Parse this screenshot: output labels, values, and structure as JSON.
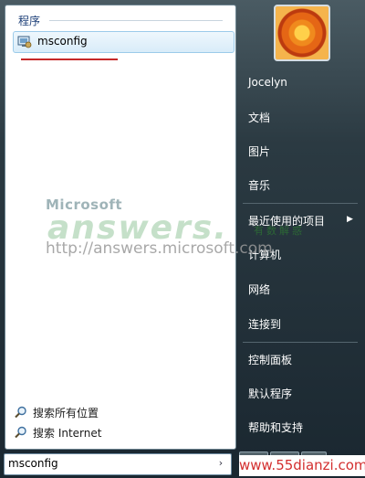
{
  "left_panel": {
    "group_title": "程序",
    "program": {
      "label": "msconfig",
      "icon": "system-config-icon"
    },
    "search_links": [
      {
        "label": "搜索所有位置",
        "icon": "magnifier-icon"
      },
      {
        "label": "搜索 Internet",
        "icon": "magnifier-icon"
      }
    ],
    "search_box": {
      "value": "msconfig",
      "go_icon": "arrow-right-icon"
    }
  },
  "right_panel": {
    "user_name": "Jocelyn",
    "items": [
      {
        "label": "文档"
      },
      {
        "label": "图片"
      },
      {
        "label": "音乐"
      },
      {
        "label": "最近使用的项目",
        "has_submenu": true
      },
      {
        "label": "计算机"
      },
      {
        "label": "网络"
      },
      {
        "label": "连接到"
      },
      {
        "label": "控制面板"
      },
      {
        "label": "默认程序"
      },
      {
        "label": "帮助和支持"
      }
    ]
  },
  "watermark": {
    "brand": "Microsoft",
    "word": "answers.",
    "chinese": "有数解惑",
    "url": "http://answers.microsoft.com"
  },
  "site_badge": {
    "text": "www.55dianzi.com"
  },
  "colors": {
    "accent_underline": "#c62828",
    "selection_border": "#9ccbea",
    "site_text": "#d32f2f"
  }
}
